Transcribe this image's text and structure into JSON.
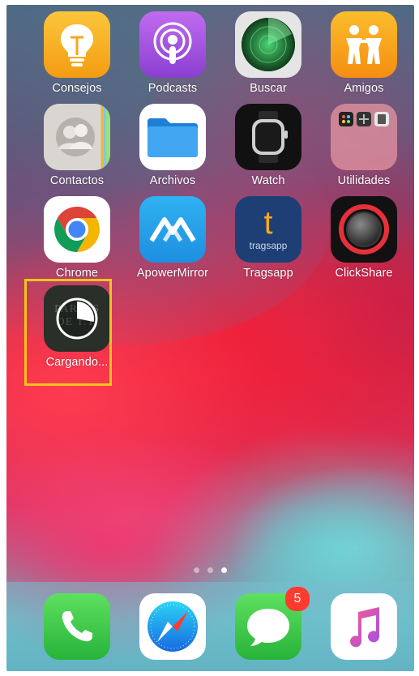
{
  "home": {
    "apps": [
      {
        "label": "Consejos",
        "icon": "lightbulb-icon"
      },
      {
        "label": "Podcasts",
        "icon": "podcast-icon"
      },
      {
        "label": "Buscar",
        "icon": "radar-icon"
      },
      {
        "label": "Amigos",
        "icon": "friends-icon"
      },
      {
        "label": "Contactos",
        "icon": "contacts-icon"
      },
      {
        "label": "Archivos",
        "icon": "folder-icon"
      },
      {
        "label": "Watch",
        "icon": "watch-icon"
      },
      {
        "label": "Utilidades",
        "icon": "folder-grid-icon"
      },
      {
        "label": "Chrome",
        "icon": "chrome-icon"
      },
      {
        "label": "ApowerMirror",
        "icon": "apowermirror-icon"
      },
      {
        "label": "Tragsapp",
        "icon": "tragsapp-icon"
      },
      {
        "label": "ClickShare",
        "icon": "clickshare-icon"
      },
      {
        "label": "Cargando...",
        "icon": "loading-app-icon",
        "icon_text": "PARTES DE T.T.",
        "download_progress": 0.28
      }
    ],
    "tragsapp_icon_letter": "t",
    "tragsapp_icon_word": "tragsapp",
    "page_dots": {
      "count": 3,
      "active_index": 2
    }
  },
  "dock": {
    "apps": [
      {
        "name": "Teléfono",
        "icon": "phone-icon"
      },
      {
        "name": "Safari",
        "icon": "compass-icon"
      },
      {
        "name": "Mensajes",
        "icon": "message-icon",
        "badge": "5"
      },
      {
        "name": "Música",
        "icon": "music-note-icon"
      }
    ]
  },
  "colors": {
    "highlight": "#f2c31a",
    "badge": "#ff3b30",
    "tips_yellow": "#f8b91a",
    "podcasts_purple": "#9b4ed8",
    "friends_orange": "#f7a81b",
    "phone_green": "#3fce4a",
    "messages_green": "#3fce4a"
  }
}
